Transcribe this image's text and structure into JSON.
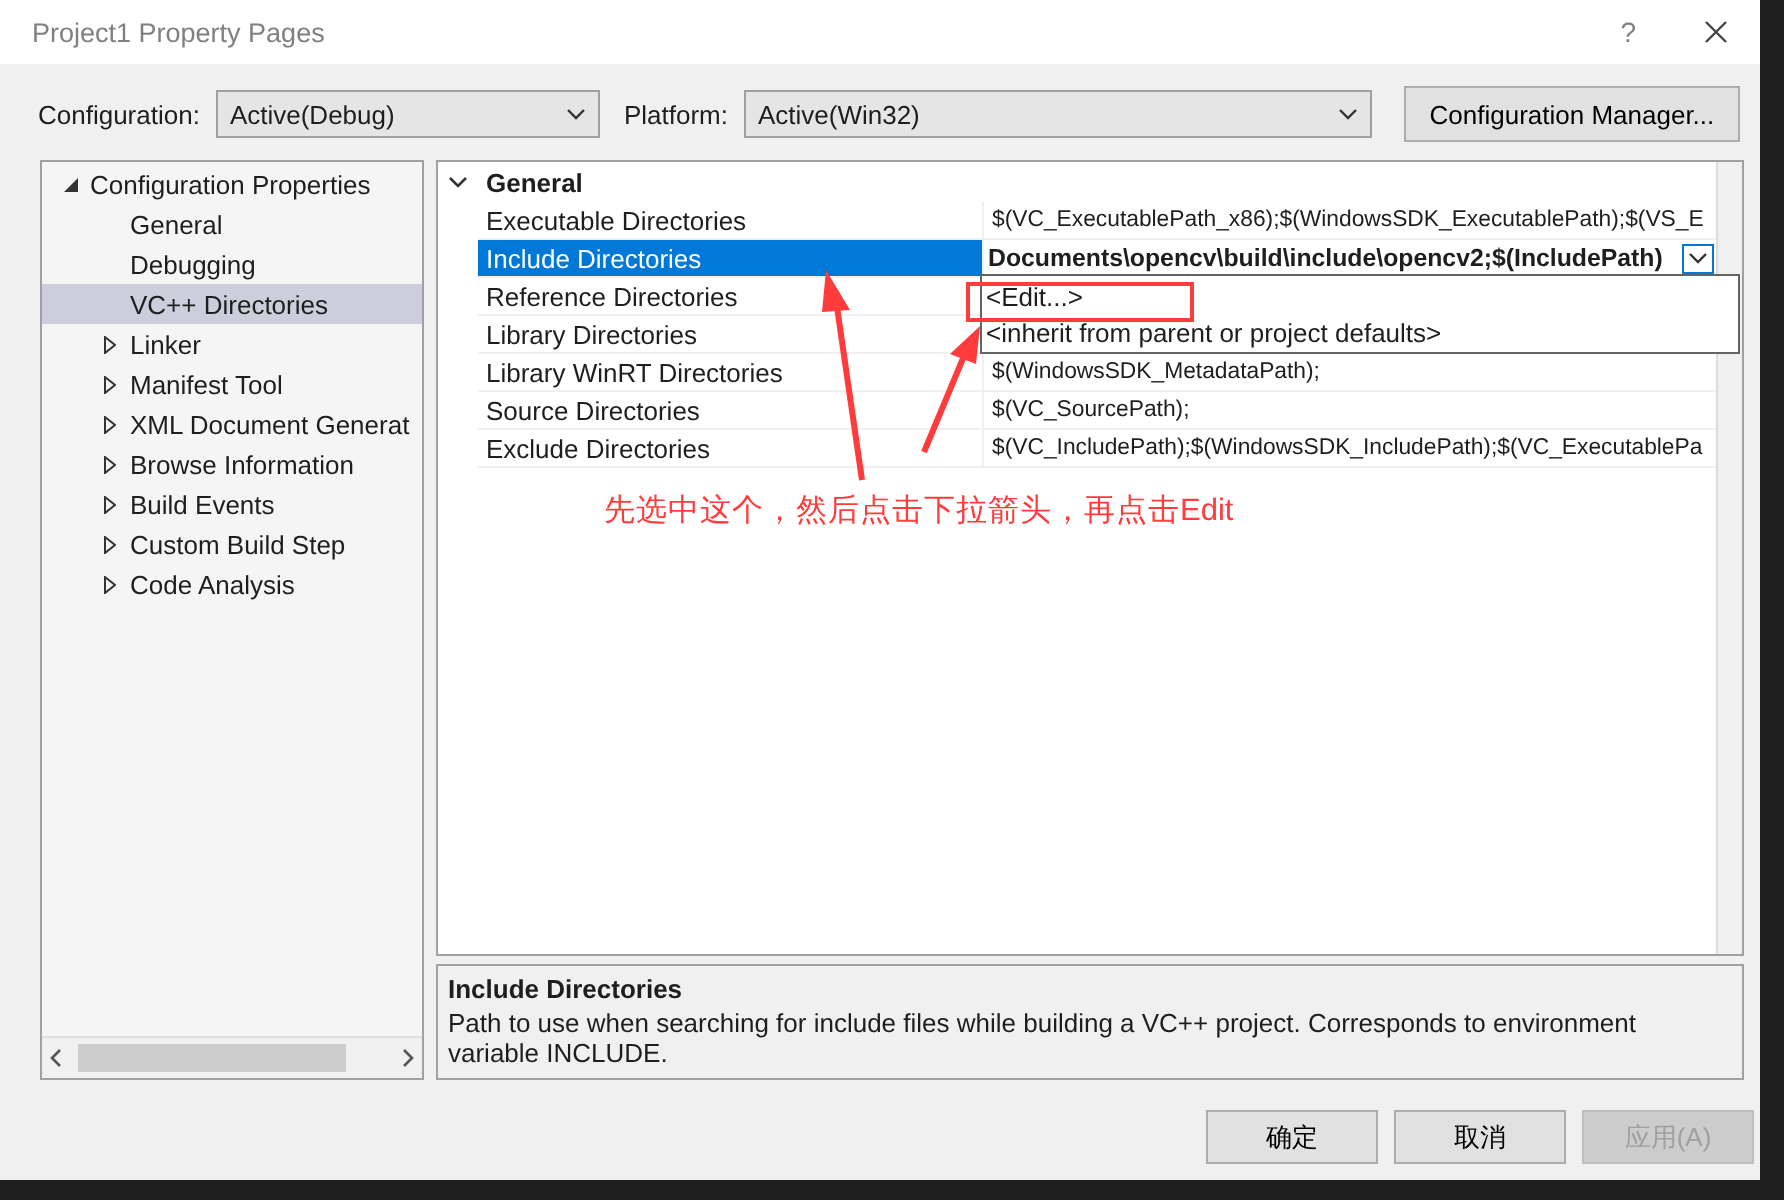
{
  "window": {
    "title": "Project1 Property Pages",
    "help": "?"
  },
  "toolbar": {
    "configuration": {
      "label": "Configuration:",
      "value": "Active(Debug)"
    },
    "platform": {
      "label": "Platform:",
      "value": "Active(Win32)"
    },
    "manager_button": "Configuration Manager..."
  },
  "tree": {
    "label": "Configuration Properties",
    "expanded": true,
    "children": [
      {
        "label": "General",
        "kind": "page",
        "selected": false
      },
      {
        "label": "Debugging",
        "kind": "page",
        "selected": false
      },
      {
        "label": "VC++ Directories",
        "kind": "page",
        "selected": true
      },
      {
        "label": "Linker",
        "kind": "group",
        "selected": false
      },
      {
        "label": "Manifest Tool",
        "kind": "group",
        "selected": false
      },
      {
        "label": "XML Document Generat",
        "kind": "group",
        "selected": false
      },
      {
        "label": "Browse Information",
        "kind": "group",
        "selected": false
      },
      {
        "label": "Build Events",
        "kind": "group",
        "selected": false
      },
      {
        "label": "Custom Build Step",
        "kind": "group",
        "selected": false
      },
      {
        "label": "Code Analysis",
        "kind": "group",
        "selected": false
      }
    ]
  },
  "grid": {
    "category": {
      "label": "General",
      "expanded": true
    },
    "rows": [
      {
        "name": "Executable Directories",
        "value": "$(VC_ExecutablePath_x86);$(WindowsSDK_ExecutablePath);$(VS_E",
        "selected": false
      },
      {
        "name": "Include Directories",
        "value": "Documents\\opencv\\build\\include\\opencv2;$(IncludePath)",
        "selected": true
      },
      {
        "name": "Reference Directories",
        "selected": false
      },
      {
        "name": "Library Directories",
        "selected": false
      },
      {
        "name": "Library WinRT Directories",
        "value": "$(WindowsSDK_MetadataPath);",
        "selected": false
      },
      {
        "name": "Source Directories",
        "value": "$(VC_SourcePath);",
        "selected": false
      },
      {
        "name": "Exclude Directories",
        "value": "$(VC_IncludePath);$(WindowsSDK_IncludePath);$(VC_ExecutablePa",
        "selected": false
      }
    ]
  },
  "dropdown_menu": {
    "items": [
      {
        "label": "<Edit...>",
        "highlighted": true
      },
      {
        "label": "<inherit from parent or project defaults>",
        "highlighted": false
      }
    ]
  },
  "annotation": {
    "note": "先选中这个，然后点击下拉箭头，再点击Edit"
  },
  "description": {
    "title": "Include Directories",
    "text": "Path to use when searching for include files while building a VC++ project.  Corresponds to environment variable INCLUDE."
  },
  "buttons": [
    {
      "label": "确定",
      "disabled": false
    },
    {
      "label": "取消",
      "disabled": false
    },
    {
      "label": "应用(A)",
      "disabled": true
    }
  ]
}
